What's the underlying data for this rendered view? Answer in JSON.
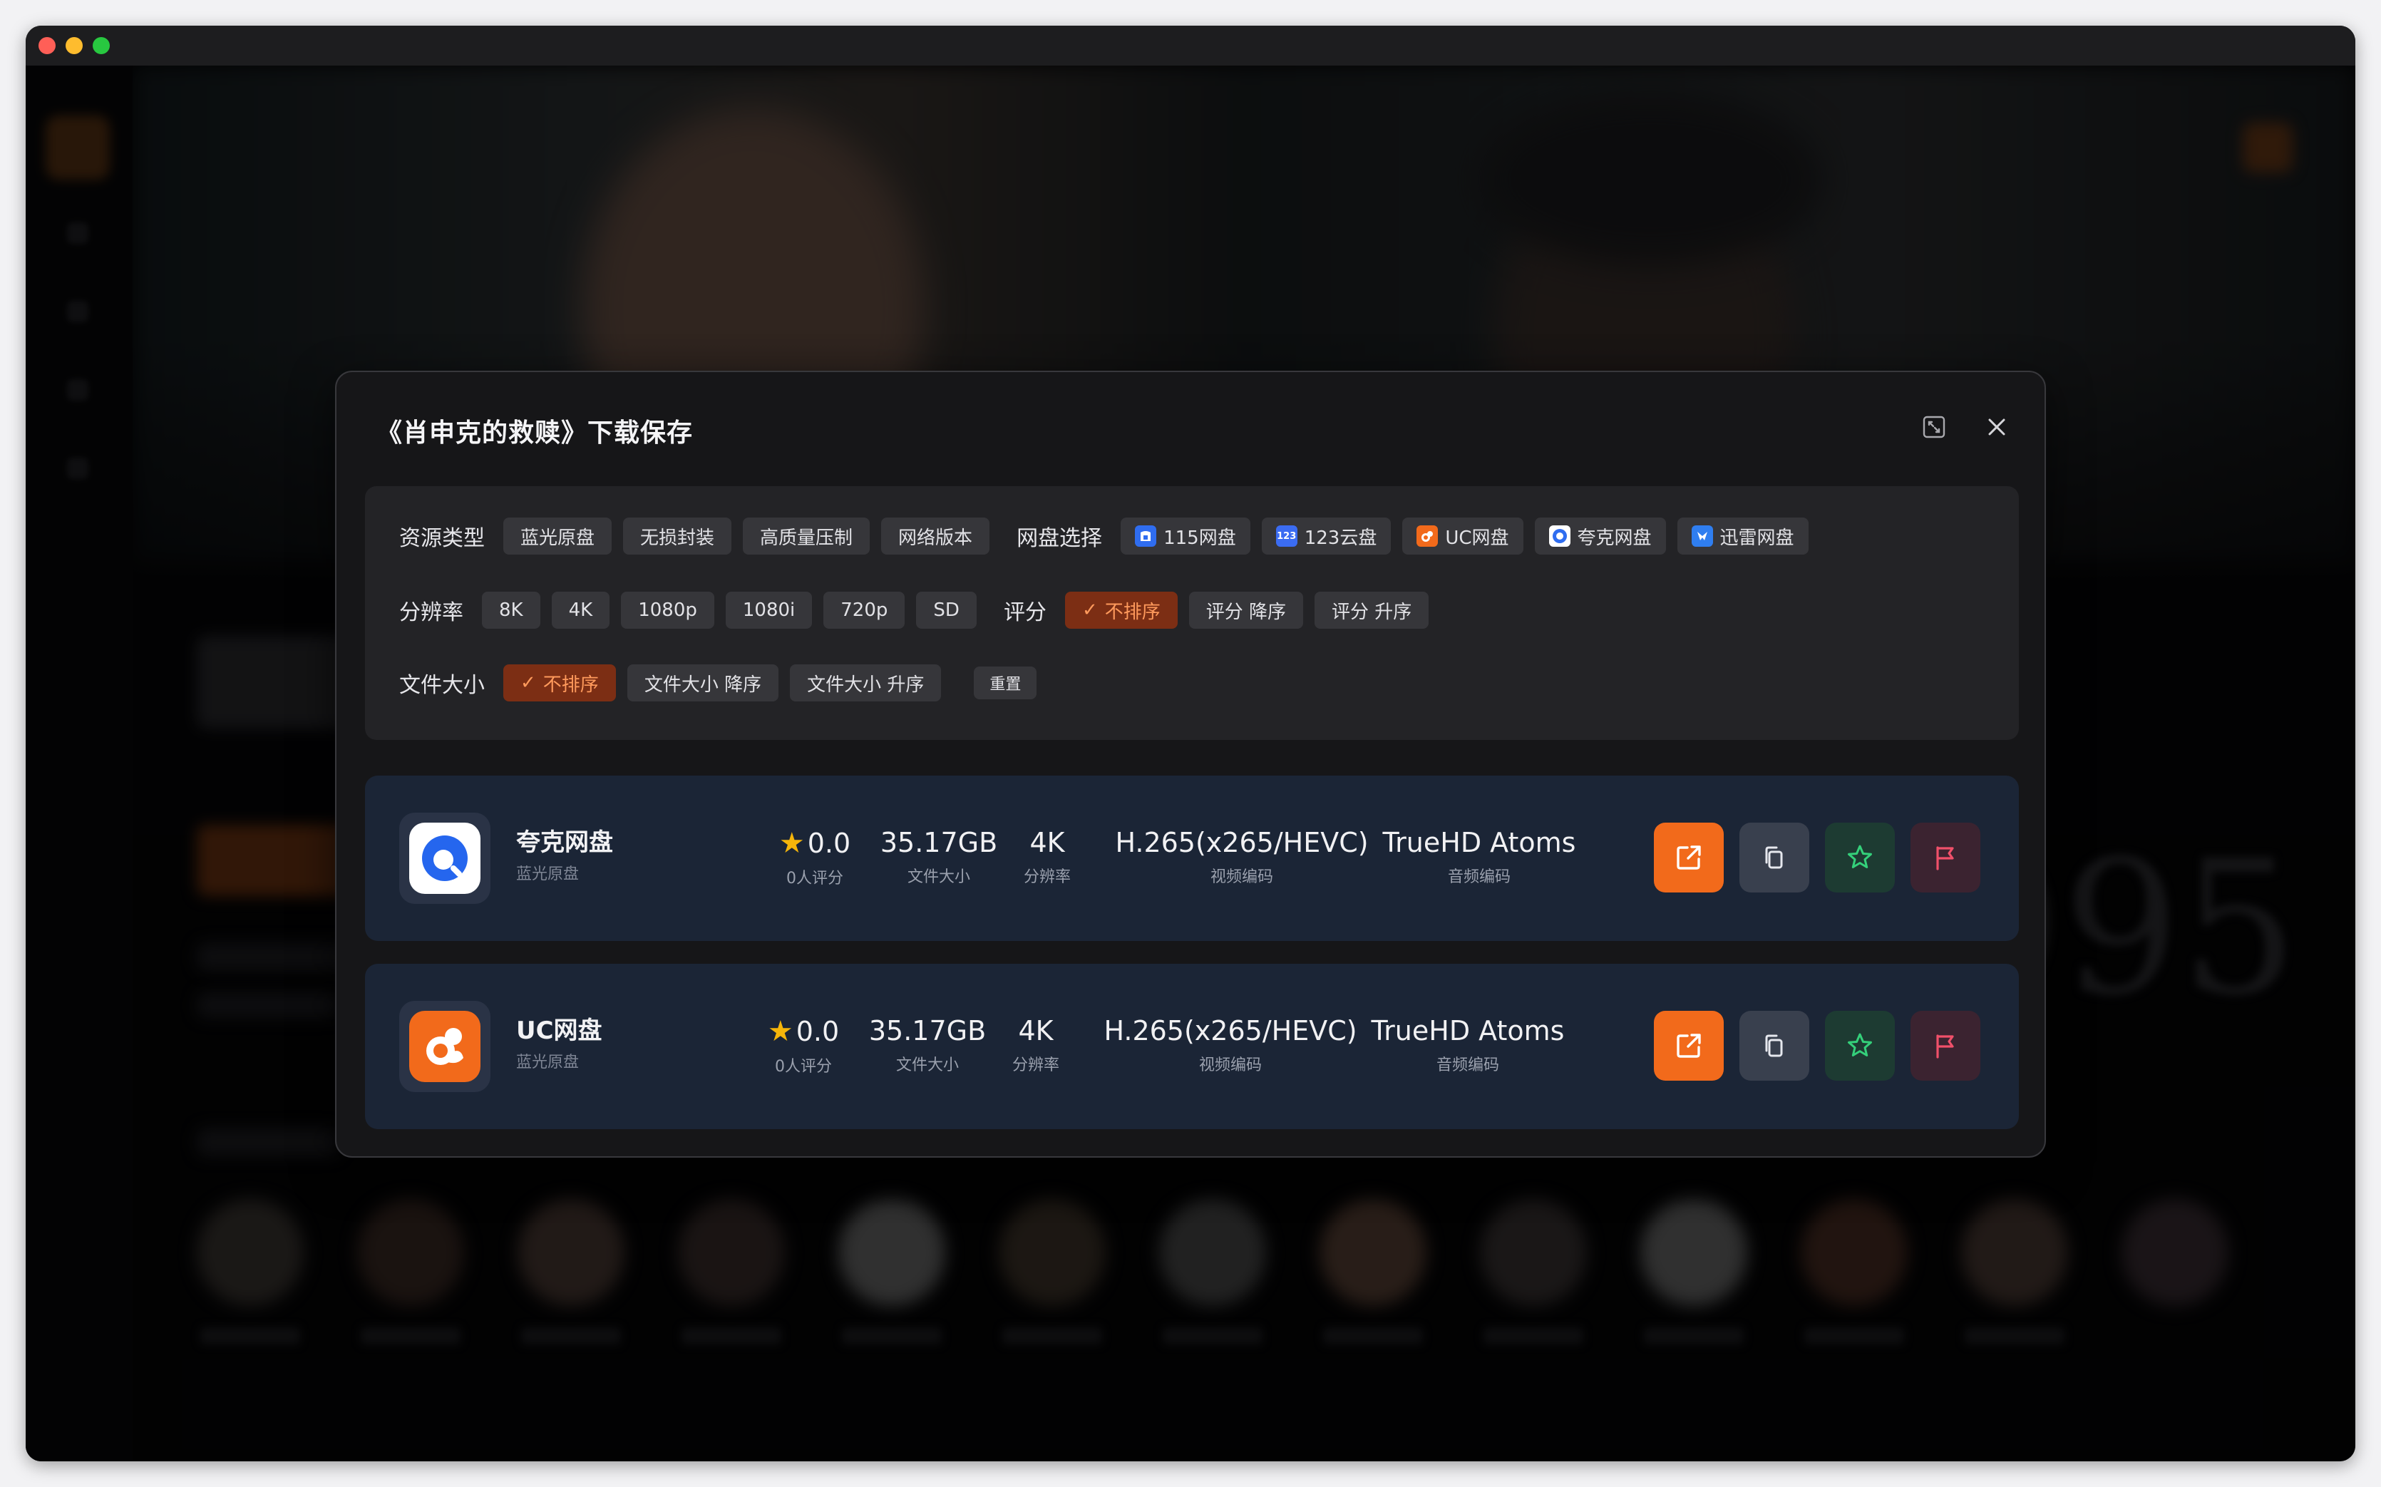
{
  "dialog": {
    "title": "《肖申克的救赎》下载保存"
  },
  "filters": {
    "resource_type": {
      "label": "资源类型",
      "options": [
        "蓝光原盘",
        "无损封装",
        "高质量压制",
        "网络版本"
      ]
    },
    "drive_select": {
      "label": "网盘选择",
      "options": [
        {
          "label": "115网盘",
          "icon": "115-drive-icon",
          "color": "#2f6df0"
        },
        {
          "label": "123云盘",
          "icon": "123-drive-icon",
          "color": "#3b6cf2"
        },
        {
          "label": "UC网盘",
          "icon": "uc-drive-icon",
          "color": "#f26a1b"
        },
        {
          "label": "夸克网盘",
          "icon": "quark-drive-icon",
          "color": "#2f6df0"
        },
        {
          "label": "迅雷网盘",
          "icon": "xunlei-drive-icon",
          "color": "#2f7ef0"
        }
      ]
    },
    "resolution": {
      "label": "分辨率",
      "options": [
        "8K",
        "4K",
        "1080p",
        "1080i",
        "720p",
        "SD"
      ]
    },
    "rating": {
      "label": "评分",
      "options": [
        "不排序",
        "评分 降序",
        "评分 升序"
      ],
      "selected": "不排序"
    },
    "file_size": {
      "label": "文件大小",
      "options": [
        "不排序",
        "文件大小 降序",
        "文件大小 升序"
      ],
      "selected": "不排序"
    },
    "reset_label": "重置"
  },
  "results": [
    {
      "name": "夸克网盘",
      "source": "蓝光原盘",
      "icon": "quark-app-icon",
      "rating": "0.0",
      "rating_label": "0人评分",
      "size": "35.17GB",
      "size_label": "文件大小",
      "resolution": "4K",
      "resolution_label": "分辨率",
      "video_codec": "H.265(x265/HEVC)",
      "video_codec_label": "视频编码",
      "audio_codec": "TrueHD Atoms",
      "audio_codec_label": "音频编码"
    },
    {
      "name": "UC网盘",
      "source": "蓝光原盘",
      "icon": "uc-app-icon",
      "rating": "0.0",
      "rating_label": "0人评分",
      "size": "35.17GB",
      "size_label": "文件大小",
      "resolution": "4K",
      "resolution_label": "分辨率",
      "video_codec": "H.265(x265/HEVC)",
      "video_codec_label": "视频编码",
      "audio_codec": "TrueHD Atoms",
      "audio_codec_label": "音频编码"
    }
  ],
  "colors": {
    "accent": "#f26a1b",
    "active_chip_bg": "#7c2e14",
    "active_chip_text": "#ff9a5c",
    "card_bg": "#1b2536",
    "dialog_bg": "#161618"
  }
}
